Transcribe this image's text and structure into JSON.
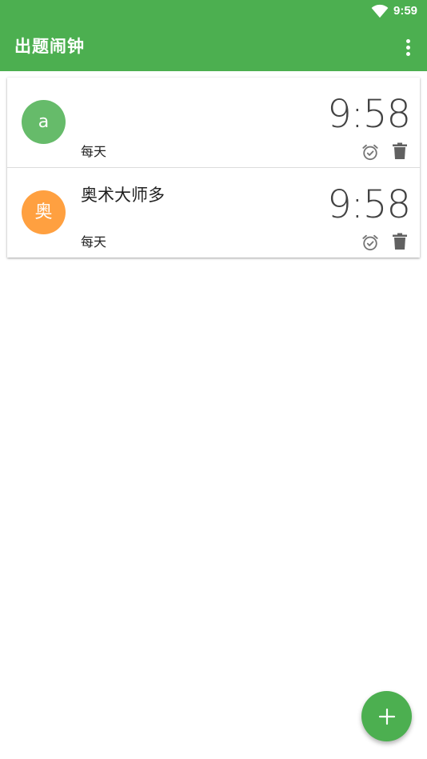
{
  "status_bar": {
    "time": "9:59",
    "wifi_icon": "wifi-icon"
  },
  "app_bar": {
    "title": "出题闹钟",
    "overflow_icon": "more-vert-icon"
  },
  "colors": {
    "primary": "#4caf50",
    "avatar_green": "#66bb6a",
    "avatar_orange": "#ffa040",
    "icon_gray": "#757575"
  },
  "alarms": [
    {
      "avatar_letter": "a",
      "avatar_color": "#66bb6a",
      "title": "",
      "time": "9:58",
      "repeat": "每天",
      "alarm_icon": "alarm-check-icon",
      "delete_icon": "delete-icon"
    },
    {
      "avatar_letter": "奥",
      "avatar_color": "#ffa040",
      "title": "奥术大师多",
      "time": "9:58",
      "repeat": "每天",
      "alarm_icon": "alarm-check-icon",
      "delete_icon": "delete-icon"
    }
  ],
  "fab": {
    "icon": "plus-icon"
  }
}
